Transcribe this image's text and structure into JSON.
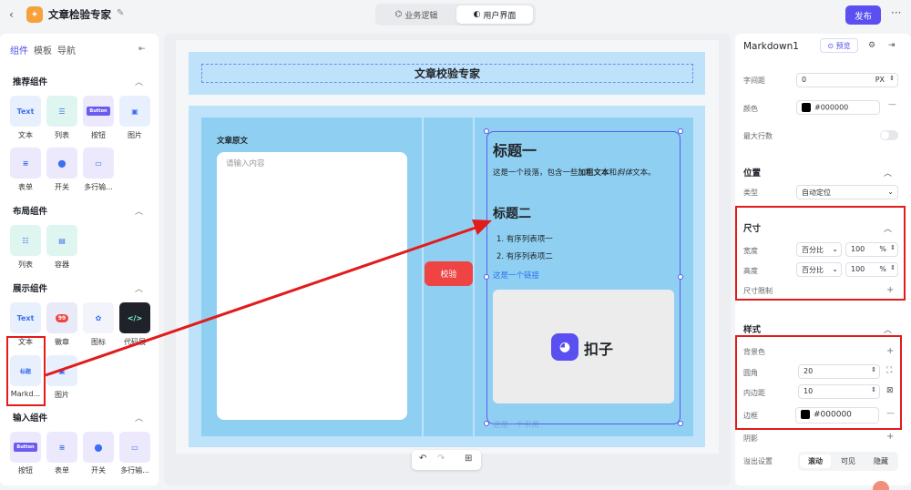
{
  "topbar": {
    "back_icon": "‹",
    "app_title": "文章检验专家",
    "modes": [
      "业务逻辑",
      "用户界面"
    ],
    "publish_label": "发布",
    "more_icon": "···"
  },
  "left_panel": {
    "tabs": [
      "组件",
      "模板",
      "导航"
    ],
    "sections": {
      "recommended": {
        "title": "推荐组件",
        "items": [
          "文本",
          "列表",
          "按钮",
          "图片",
          "表单",
          "开关",
          "多行输..."
        ]
      },
      "layout": {
        "title": "布局组件",
        "items": [
          "列表",
          "容器"
        ]
      },
      "display": {
        "title": "展示组件",
        "items": [
          "文本",
          "徽章",
          "图标",
          "代码展",
          "Markd...",
          "图片"
        ]
      },
      "input": {
        "title": "输入组件",
        "items": [
          "按钮",
          "表单",
          "开关",
          "多行输..."
        ]
      }
    },
    "icon_text": {
      "text": "Text",
      "button": "Button",
      "badge": "99",
      "md": "标题"
    }
  },
  "canvas": {
    "header_title": "文章校验专家",
    "original_label": "文章原文",
    "input_placeholder": "请输入内容",
    "verify_button": "校验",
    "markdown": {
      "h1": "标题一",
      "para_prefix": "这是一个段落，包含一些",
      "para_bold": "加粗文本",
      "para_mid": "和",
      "para_italic": "斜体",
      "para_suffix": "文本。",
      "h2": "标题二",
      "list": [
        "1. 有序列表项一",
        "2. 有序列表项二"
      ],
      "link": "这是一个链接",
      "image_brand": "扣子",
      "faded": "这是一个引用"
    }
  },
  "right_panel": {
    "component_name": "Markdown1",
    "preview_label": "预览",
    "letter_spacing_label": "字间距",
    "letter_spacing_value": "0",
    "letter_spacing_unit": "PX",
    "color_label": "颜色",
    "color_value": "#000000",
    "max_lines_label": "最大行数",
    "position_title": "位置",
    "type_label": "类型",
    "type_value": "自动定位",
    "size_title": "尺寸",
    "width_label": "宽度",
    "height_label": "高度",
    "size_mode": "百分比",
    "size_value": "100",
    "size_unit": "%",
    "size_limit_label": "尺寸限制",
    "style_title": "样式",
    "bg_label": "背景色",
    "radius_label": "圆角",
    "radius_value": "20",
    "padding_label": "内边距",
    "padding_value": "10",
    "border_label": "边框",
    "border_value": "#000000",
    "shadow_label": "阴影",
    "overflow_label": "溢出设置",
    "overflow_options": [
      "滚动",
      "可见",
      "隐藏"
    ]
  },
  "colors": {
    "accent": "#5a4ff0",
    "annotation": "#e21b1b",
    "band": "#bfe2fb",
    "column": "#8fd0f2"
  }
}
